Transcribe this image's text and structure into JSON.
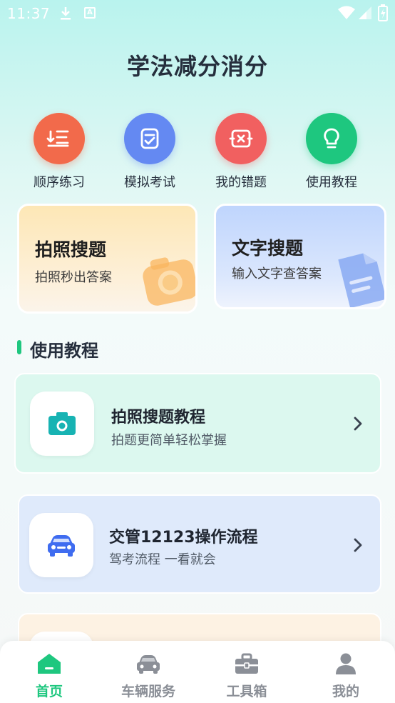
{
  "status_bar": {
    "time": "11:37",
    "a_badge": "A"
  },
  "page": {
    "title": "学法减分消分"
  },
  "quick_actions": [
    {
      "label": "顺序练习",
      "icon": "list-order-icon",
      "color": "#f26a4b"
    },
    {
      "label": "模拟考试",
      "icon": "exam-check-icon",
      "color": "#6489f2"
    },
    {
      "label": "我的错题",
      "icon": "wrong-answer-icon",
      "color": "#f16060"
    },
    {
      "label": "使用教程",
      "icon": "lightbulb-icon",
      "color": "#1ec77f"
    }
  ],
  "search_cards": [
    {
      "title": "拍照搜题",
      "subtitle": "拍照秒出答案",
      "icon": "camera-icon"
    },
    {
      "title": "文字搜题",
      "subtitle": "输入文字查答案",
      "icon": "document-icon"
    }
  ],
  "section": {
    "title": "使用教程"
  },
  "tutorials": [
    {
      "title": "拍照搜题教程",
      "subtitle": "拍题更简单轻松掌握",
      "icon": "camera-icon"
    },
    {
      "title": "交管12123操作流程",
      "subtitle": "驾考流程 一看就会",
      "icon": "car-icon"
    },
    {
      "title": "",
      "subtitle": "",
      "icon": ""
    }
  ],
  "bottom_nav": [
    {
      "label": "首页",
      "icon": "home-icon",
      "active": true
    },
    {
      "label": "车辆服务",
      "icon": "car-icon",
      "active": false
    },
    {
      "label": "工具箱",
      "icon": "toolbox-icon",
      "active": false
    },
    {
      "label": "我的",
      "icon": "user-icon",
      "active": false
    }
  ],
  "colors": {
    "accent": "#1ec77f",
    "nav_inactive": "#8b8f97",
    "title": "#262f3d"
  }
}
